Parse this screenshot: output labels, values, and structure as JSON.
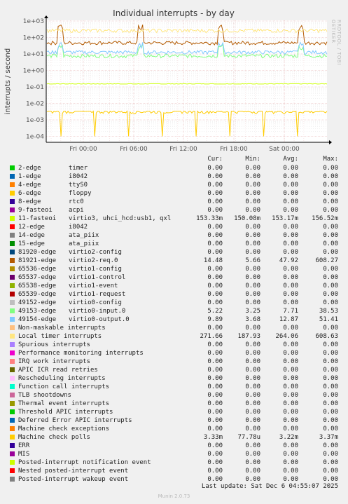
{
  "chart_data": {
    "type": "line",
    "title": "Individual interrupts - by day",
    "ylabel": "interrupts / second",
    "yscale": "log",
    "ylim": [
      0.0001,
      1000
    ],
    "yticks": [
      "1e+03",
      "1e+02",
      "1e+01",
      "1e+00",
      "1e-01",
      "1e-02",
      "1e-03",
      "1e-04"
    ],
    "xticks": [
      "Fri 00:00",
      "Fri 06:00",
      "Fri 12:00",
      "Fri 18:00",
      "Sat 00:00"
    ],
    "grid": true,
    "side_label": "RRDTOOL / TOBI OETIKER",
    "columns": [
      "Cur:",
      "Min:",
      "Avg:",
      "Max:"
    ],
    "series": [
      {
        "name": "2-edge",
        "desc": "timer",
        "color": "#00cc00",
        "cur": "0.00",
        "min": "0.00",
        "avg": "0.00",
        "max": "0.00"
      },
      {
        "name": "1-edge",
        "desc": "i8042",
        "color": "#0066b3",
        "cur": "0.00",
        "min": "0.00",
        "avg": "0.00",
        "max": "0.00"
      },
      {
        "name": "4-edge",
        "desc": "ttyS0",
        "color": "#ff8000",
        "cur": "0.00",
        "min": "0.00",
        "avg": "0.00",
        "max": "0.00"
      },
      {
        "name": "6-edge",
        "desc": "floppy",
        "color": "#ffcc00",
        "cur": "0.00",
        "min": "0.00",
        "avg": "0.00",
        "max": "0.00"
      },
      {
        "name": "8-edge",
        "desc": "rtc0",
        "color": "#330099",
        "cur": "0.00",
        "min": "0.00",
        "avg": "0.00",
        "max": "0.00"
      },
      {
        "name": "9-fasteoi",
        "desc": "acpi",
        "color": "#990099",
        "cur": "0.00",
        "min": "0.00",
        "avg": "0.00",
        "max": "0.00"
      },
      {
        "name": "11-fasteoi",
        "desc": "virtio3, uhci_hcd:usb1, qxl",
        "color": "#ccff00",
        "cur": "153.33m",
        "min": "150.08m",
        "avg": "153.17m",
        "max": "156.52m"
      },
      {
        "name": "12-edge",
        "desc": "i8042",
        "color": "#ff0000",
        "cur": "0.00",
        "min": "0.00",
        "avg": "0.00",
        "max": "0.00"
      },
      {
        "name": "14-edge",
        "desc": "ata_piix",
        "color": "#808080",
        "cur": "0.00",
        "min": "0.00",
        "avg": "0.00",
        "max": "0.00"
      },
      {
        "name": "15-edge",
        "desc": "ata_piix",
        "color": "#008f00",
        "cur": "0.00",
        "min": "0.00",
        "avg": "0.00",
        "max": "0.00"
      },
      {
        "name": "81920-edge",
        "desc": "virtio2-config",
        "color": "#00487d",
        "cur": "0.00",
        "min": "0.00",
        "avg": "0.00",
        "max": "0.00"
      },
      {
        "name": "81921-edge",
        "desc": "virtio2-req.0",
        "color": "#b35a00",
        "cur": "14.48",
        "min": "5.66",
        "avg": "47.92",
        "max": "608.27"
      },
      {
        "name": "65536-edge",
        "desc": "virtio1-config",
        "color": "#b38f00",
        "cur": "0.00",
        "min": "0.00",
        "avg": "0.00",
        "max": "0.00"
      },
      {
        "name": "65537-edge",
        "desc": "virtio1-control",
        "color": "#6b006b",
        "cur": "0.00",
        "min": "0.00",
        "avg": "0.00",
        "max": "0.00"
      },
      {
        "name": "65538-edge",
        "desc": "virtio1-event",
        "color": "#8fb300",
        "cur": "0.00",
        "min": "0.00",
        "avg": "0.00",
        "max": "0.00"
      },
      {
        "name": "65539-edge",
        "desc": "virtio1-request",
        "color": "#b30000",
        "cur": "0.00",
        "min": "0.00",
        "avg": "0.00",
        "max": "0.00"
      },
      {
        "name": "49152-edge",
        "desc": "virtio0-config",
        "color": "#bebebe",
        "cur": "0.00",
        "min": "0.00",
        "avg": "0.00",
        "max": "0.00"
      },
      {
        "name": "49153-edge",
        "desc": "virtio0-input.0",
        "color": "#80ff80",
        "cur": "5.22",
        "min": "3.25",
        "avg": "7.71",
        "max": "38.53"
      },
      {
        "name": "49154-edge",
        "desc": "virtio0-output.0",
        "color": "#80c9ff",
        "cur": "9.89",
        "min": "3.68",
        "avg": "12.87",
        "max": "51.41"
      },
      {
        "name": "Non-maskable interrupts",
        "desc": "",
        "color": "#ffc080",
        "cur": "0.00",
        "min": "0.00",
        "avg": "0.00",
        "max": "0.00"
      },
      {
        "name": "Local timer interrupts",
        "desc": "",
        "color": "#ffe680",
        "cur": "271.66",
        "min": "187.93",
        "avg": "264.06",
        "max": "608.63"
      },
      {
        "name": "Spurious interrupts",
        "desc": "",
        "color": "#aa80ff",
        "cur": "0.00",
        "min": "0.00",
        "avg": "0.00",
        "max": "0.00"
      },
      {
        "name": "Performance monitoring interrupts",
        "desc": "",
        "color": "#ee00cc",
        "cur": "0.00",
        "min": "0.00",
        "avg": "0.00",
        "max": "0.00"
      },
      {
        "name": "IRQ work interrupts",
        "desc": "",
        "color": "#ff8080",
        "cur": "0.00",
        "min": "0.00",
        "avg": "0.00",
        "max": "0.00"
      },
      {
        "name": "APIC ICR read retries",
        "desc": "",
        "color": "#666600",
        "cur": "0.00",
        "min": "0.00",
        "avg": "0.00",
        "max": "0.00"
      },
      {
        "name": "Rescheduling interrupts",
        "desc": "",
        "color": "#ffbfff",
        "cur": "0.00",
        "min": "0.00",
        "avg": "0.00",
        "max": "0.00"
      },
      {
        "name": "Function call interrupts",
        "desc": "",
        "color": "#00ffcc",
        "cur": "0.00",
        "min": "0.00",
        "avg": "0.00",
        "max": "0.00"
      },
      {
        "name": "TLB shootdowns",
        "desc": "",
        "color": "#cc6699",
        "cur": "0.00",
        "min": "0.00",
        "avg": "0.00",
        "max": "0.00"
      },
      {
        "name": "Thermal event interrupts",
        "desc": "",
        "color": "#999900",
        "cur": "0.00",
        "min": "0.00",
        "avg": "0.00",
        "max": "0.00"
      },
      {
        "name": "Threshold APIC interrupts",
        "desc": "",
        "color": "#00cc00",
        "cur": "0.00",
        "min": "0.00",
        "avg": "0.00",
        "max": "0.00"
      },
      {
        "name": "Deferred Error APIC interrupts",
        "desc": "",
        "color": "#0066b3",
        "cur": "0.00",
        "min": "0.00",
        "avg": "0.00",
        "max": "0.00"
      },
      {
        "name": "Machine check exceptions",
        "desc": "",
        "color": "#ff8000",
        "cur": "0.00",
        "min": "0.00",
        "avg": "0.00",
        "max": "0.00"
      },
      {
        "name": "Machine check polls",
        "desc": "",
        "color": "#ffcc00",
        "cur": "3.33m",
        "min": "77.78u",
        "avg": "3.22m",
        "max": "3.37m"
      },
      {
        "name": "ERR",
        "desc": "",
        "color": "#330099",
        "cur": "0.00",
        "min": "0.00",
        "avg": "0.00",
        "max": "0.00"
      },
      {
        "name": "MIS",
        "desc": "",
        "color": "#990099",
        "cur": "0.00",
        "min": "0.00",
        "avg": "0.00",
        "max": "0.00"
      },
      {
        "name": "Posted-interrupt notification event",
        "desc": "",
        "color": "#ccff00",
        "cur": "0.00",
        "min": "0.00",
        "avg": "0.00",
        "max": "0.00"
      },
      {
        "name": "Nested posted-interrupt event",
        "desc": "",
        "color": "#ff0000",
        "cur": "0.00",
        "min": "0.00",
        "avg": "0.00",
        "max": "0.00"
      },
      {
        "name": "Posted-interrupt wakeup event",
        "desc": "",
        "color": "#808080",
        "cur": "0.00",
        "min": "0.00",
        "avg": "0.00",
        "max": "0.00"
      }
    ]
  },
  "last_update": "Last update: Sat Dec  6 04:55:07 2025",
  "footer": "Munin 2.0.73"
}
